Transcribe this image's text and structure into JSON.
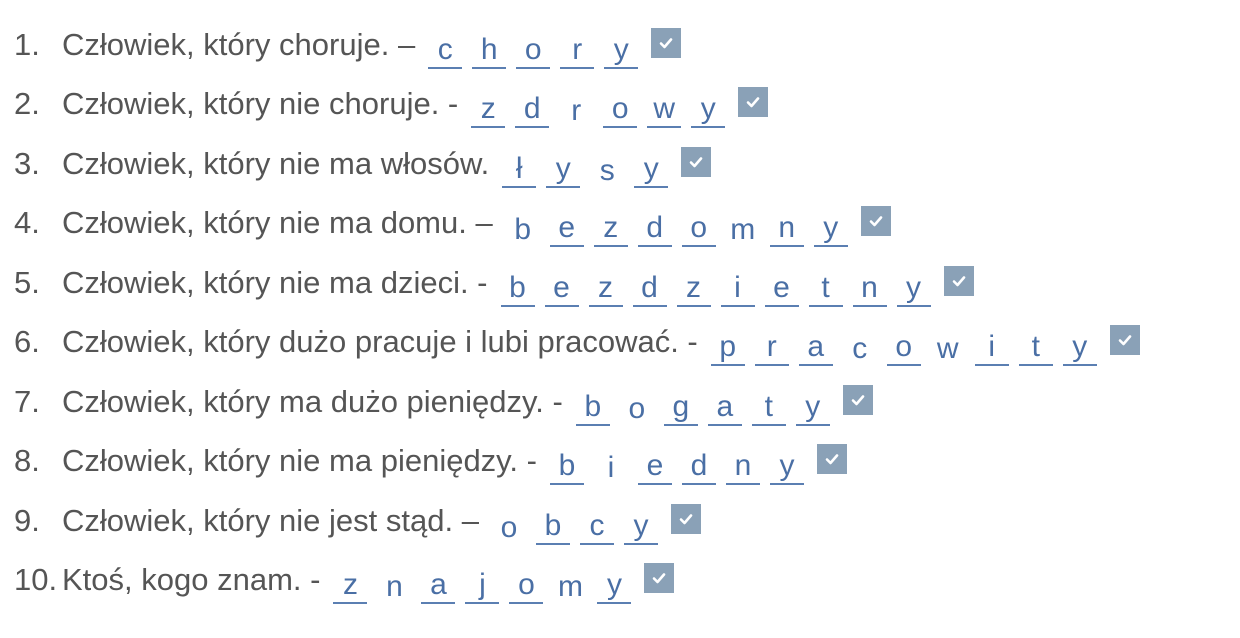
{
  "colors": {
    "prompt_text": "#555555",
    "answer_text": "#4a6fa5",
    "blank_underline": "#5b7fb2",
    "check_bg": "#8aa1b7",
    "check_mark": "#ffffff"
  },
  "items": [
    {
      "number": "1.",
      "prompt": "Człowiek, który choruje. –",
      "letters": [
        {
          "char": "c",
          "blank": true
        },
        {
          "char": "h",
          "blank": true
        },
        {
          "char": "o",
          "blank": true
        },
        {
          "char": "r",
          "blank": true
        },
        {
          "char": "y",
          "blank": true
        }
      ],
      "checked": true,
      "check_icon": "check-icon"
    },
    {
      "number": "2.",
      "prompt": "Człowiek, który nie choruje. -",
      "letters": [
        {
          "char": "z",
          "blank": true
        },
        {
          "char": "d",
          "blank": true
        },
        {
          "char": "r",
          "blank": false
        },
        {
          "char": "o",
          "blank": true
        },
        {
          "char": "w",
          "blank": true
        },
        {
          "char": "y",
          "blank": true
        }
      ],
      "checked": true,
      "check_icon": "check-icon"
    },
    {
      "number": "3.",
      "prompt": "Człowiek, który nie ma włosów.",
      "letters": [
        {
          "char": "ł",
          "blank": true
        },
        {
          "char": "y",
          "blank": true
        },
        {
          "char": "s",
          "blank": false
        },
        {
          "char": "y",
          "blank": true
        }
      ],
      "checked": true,
      "check_icon": "check-icon"
    },
    {
      "number": "4.",
      "prompt": "Człowiek, który nie ma domu. –",
      "letters": [
        {
          "char": "b",
          "blank": false
        },
        {
          "char": "e",
          "blank": true
        },
        {
          "char": "z",
          "blank": true
        },
        {
          "char": "d",
          "blank": true
        },
        {
          "char": "o",
          "blank": true
        },
        {
          "char": "m",
          "blank": false
        },
        {
          "char": "n",
          "blank": true
        },
        {
          "char": "y",
          "blank": true
        }
      ],
      "checked": true,
      "check_icon": "check-icon"
    },
    {
      "number": "5.",
      "prompt": "Człowiek, który nie ma dzieci. -",
      "letters": [
        {
          "char": "b",
          "blank": true
        },
        {
          "char": "e",
          "blank": true
        },
        {
          "char": "z",
          "blank": true
        },
        {
          "char": "d",
          "blank": true
        },
        {
          "char": "z",
          "blank": true
        },
        {
          "char": "i",
          "blank": true
        },
        {
          "char": "e",
          "blank": true
        },
        {
          "char": "t",
          "blank": true
        },
        {
          "char": "n",
          "blank": true
        },
        {
          "char": "y",
          "blank": true
        }
      ],
      "checked": true,
      "check_icon": "check-icon"
    },
    {
      "number": "6.",
      "prompt": "Człowiek, który dużo pracuje i lubi pracować. -",
      "letters": [
        {
          "char": "p",
          "blank": true
        },
        {
          "char": "r",
          "blank": true
        },
        {
          "char": "a",
          "blank": true
        },
        {
          "char": "c",
          "blank": false
        },
        {
          "char": "o",
          "blank": true
        },
        {
          "char": "w",
          "blank": false
        },
        {
          "char": "i",
          "blank": true
        },
        {
          "char": "t",
          "blank": true
        },
        {
          "char": "y",
          "blank": true
        }
      ],
      "checked": true,
      "check_icon": "check-icon"
    },
    {
      "number": "7.",
      "prompt": "Człowiek, który ma dużo pieniędzy. -",
      "letters": [
        {
          "char": "b",
          "blank": true
        },
        {
          "char": "o",
          "blank": false
        },
        {
          "char": "g",
          "blank": true
        },
        {
          "char": "a",
          "blank": true
        },
        {
          "char": "t",
          "blank": true
        },
        {
          "char": "y",
          "blank": true
        }
      ],
      "checked": true,
      "check_icon": "check-icon"
    },
    {
      "number": "8.",
      "prompt": "Człowiek, który nie ma pieniędzy. -",
      "letters": [
        {
          "char": "b",
          "blank": true
        },
        {
          "char": "i",
          "blank": false
        },
        {
          "char": "e",
          "blank": true
        },
        {
          "char": "d",
          "blank": true
        },
        {
          "char": "n",
          "blank": true
        },
        {
          "char": "y",
          "blank": true
        }
      ],
      "checked": true,
      "check_icon": "check-icon"
    },
    {
      "number": "9.",
      "prompt": "Człowiek, który nie jest stąd. –",
      "letters": [
        {
          "char": "o",
          "blank": false
        },
        {
          "char": "b",
          "blank": true
        },
        {
          "char": "c",
          "blank": true
        },
        {
          "char": "y",
          "blank": true
        }
      ],
      "checked": true,
      "check_icon": "check-icon"
    },
    {
      "number": "10.",
      "prompt": "Ktoś, kogo znam. -",
      "letters": [
        {
          "char": "z",
          "blank": true
        },
        {
          "char": "n",
          "blank": false
        },
        {
          "char": "a",
          "blank": true
        },
        {
          "char": "j",
          "blank": true
        },
        {
          "char": "o",
          "blank": true
        },
        {
          "char": "m",
          "blank": false
        },
        {
          "char": "y",
          "blank": true
        }
      ],
      "checked": true,
      "check_icon": "check-icon"
    }
  ]
}
